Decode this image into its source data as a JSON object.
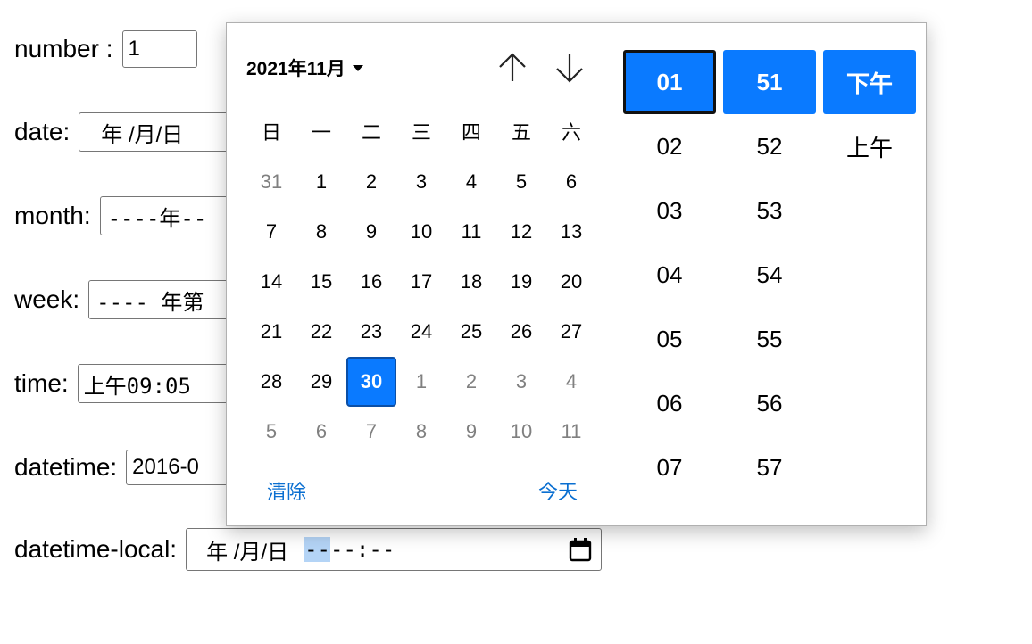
{
  "form": {
    "number": {
      "label": "number :",
      "value": "1"
    },
    "date": {
      "label": "date:",
      "value": "年 /月/日"
    },
    "month": {
      "label": "month:",
      "value": "----年--"
    },
    "week": {
      "label": "week:",
      "value": "---- 年第"
    },
    "time": {
      "label": "time:",
      "value": "上午09:05"
    },
    "datetime": {
      "label": "datetime:",
      "value": "2016-0"
    },
    "datetime_local": {
      "label": "datetime-local:",
      "date_part": "年 /月/日",
      "hour_part": "--",
      "rest_part": "--:--",
      "icon": "calendar-icon"
    }
  },
  "picker": {
    "month_title": "2021年11月",
    "nav_up_icon": "arrow-up-icon",
    "nav_down_icon": "arrow-down-icon",
    "weekdays": [
      "日",
      "一",
      "二",
      "三",
      "四",
      "五",
      "六"
    ],
    "weeks": [
      [
        "31",
        "1",
        "2",
        "3",
        "4",
        "5",
        "6"
      ],
      [
        "7",
        "8",
        "9",
        "10",
        "11",
        "12",
        "13"
      ],
      [
        "14",
        "15",
        "16",
        "17",
        "18",
        "19",
        "20"
      ],
      [
        "21",
        "22",
        "23",
        "24",
        "25",
        "26",
        "27"
      ],
      [
        "28",
        "29",
        "30",
        "1",
        "2",
        "3",
        "4"
      ],
      [
        "5",
        "6",
        "7",
        "8",
        "9",
        "10",
        "11"
      ]
    ],
    "selected_day": "30",
    "clear_label": "清除",
    "today_label": "今天",
    "hours": [
      "01",
      "02",
      "03",
      "04",
      "05",
      "06",
      "07"
    ],
    "minutes": [
      "51",
      "52",
      "53",
      "54",
      "55",
      "56",
      "57"
    ],
    "ampm": [
      "下午",
      "上午"
    ],
    "colors": {
      "accent": "#0a7aff",
      "link": "#0a6fd1",
      "muted": "#808080"
    }
  }
}
